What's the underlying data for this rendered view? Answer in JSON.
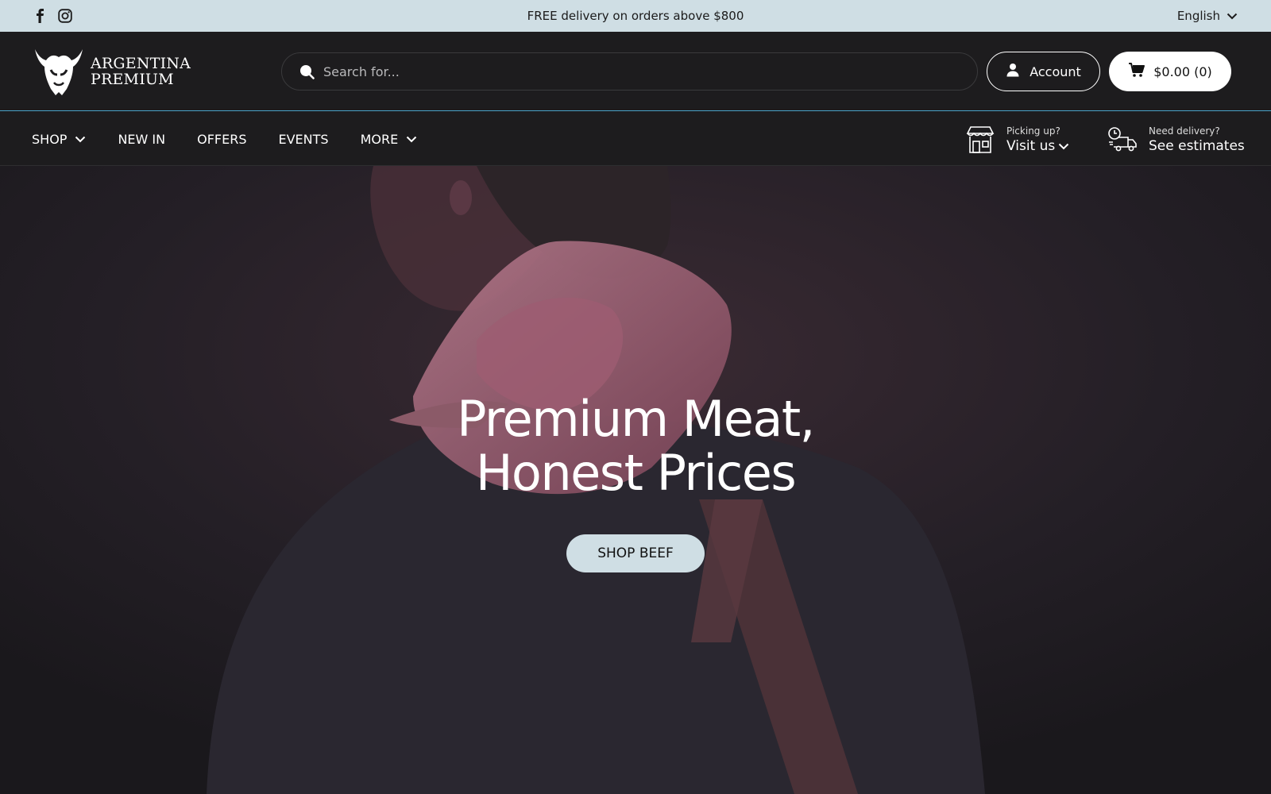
{
  "announcement": {
    "message": "FREE delivery on orders above $800",
    "language": "English",
    "social": [
      "facebook-icon",
      "instagram-icon"
    ]
  },
  "header": {
    "logo_line1": "ARGENTINA",
    "logo_line2": "PREMIUM",
    "search_placeholder": "Search for...",
    "account_label": "Account",
    "cart_label": "$0.00 (0)"
  },
  "nav": {
    "items": [
      {
        "label": "SHOP",
        "dropdown": true
      },
      {
        "label": "NEW IN",
        "dropdown": false
      },
      {
        "label": "OFFERS",
        "dropdown": false
      },
      {
        "label": "EVENTS",
        "dropdown": false
      },
      {
        "label": "MORE",
        "dropdown": true
      }
    ],
    "pickup": {
      "small": "Picking up?",
      "big": "Visit us"
    },
    "delivery": {
      "small": "Need delivery?",
      "big": "See estimates"
    }
  },
  "hero": {
    "title_line1": "Premium Meat,",
    "title_line2": "Honest Prices",
    "cta_label": "SHOP BEEF"
  },
  "colors": {
    "accent": "#cfdee4",
    "background": "#1d1c1e",
    "header_border": "#4aa3c8"
  }
}
